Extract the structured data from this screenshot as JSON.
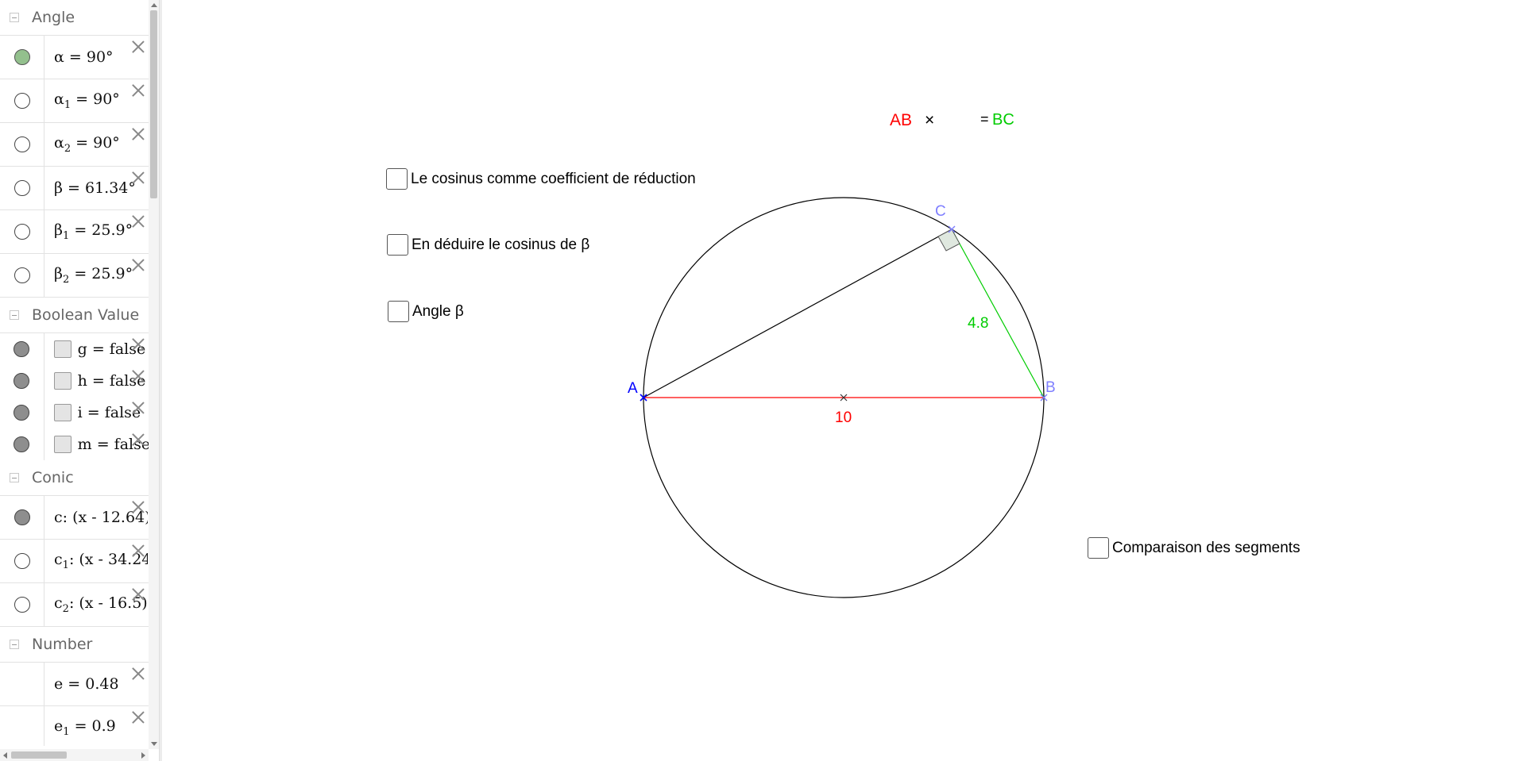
{
  "algebra": {
    "categories": [
      {
        "title": "Angle",
        "items": [
          {
            "name": "α",
            "sub": "",
            "value": "= 90°",
            "marble": "on-green"
          },
          {
            "name": "α",
            "sub": "1",
            "value": "= 90°",
            "marble": "off"
          },
          {
            "name": "α",
            "sub": "2",
            "value": "= 90°",
            "marble": "off"
          },
          {
            "name": "β",
            "sub": "",
            "value": "= 61.34°",
            "marble": "off"
          },
          {
            "name": "β",
            "sub": "1",
            "value": "= 25.9°",
            "marble": "off"
          },
          {
            "name": "β",
            "sub": "2",
            "value": "= 25.9°",
            "marble": "off"
          }
        ]
      },
      {
        "title": "Boolean Value",
        "items": [
          {
            "name": "g",
            "value": "= false",
            "marble": "on"
          },
          {
            "name": "h",
            "value": "= false",
            "marble": "on"
          },
          {
            "name": "i",
            "value": "= false",
            "marble": "on"
          },
          {
            "name": "m",
            "value": "= false",
            "marble": "on"
          }
        ]
      },
      {
        "title": "Conic",
        "items": [
          {
            "name": "c",
            "sub": "",
            "value": ": (x - 12.64)",
            "marble": "on"
          },
          {
            "name": "c",
            "sub": "1",
            "value": ": (x - 34.24",
            "marble": "off"
          },
          {
            "name": "c",
            "sub": "2",
            "value": ": (x - 16.5)",
            "marble": "off"
          }
        ]
      },
      {
        "title": "Number",
        "items": [
          {
            "name": "e",
            "sub": "",
            "value": "= 0.48",
            "marble": "none"
          },
          {
            "name": "e",
            "sub": "1",
            "value": "= 0.9",
            "marble": "none"
          }
        ]
      }
    ]
  },
  "graphics": {
    "checkboxes": {
      "cosinus_reduction": "Le cosinus comme coefficient de réduction",
      "deduire_cosinus": "En déduire le cosinus de β",
      "angle_beta": "Angle β",
      "comparaison": "Comparaison des segments"
    },
    "formula": {
      "ab": "AB",
      "times": "×",
      "equals": "=",
      "bc": "BC"
    },
    "points": {
      "a": "A",
      "b": "B",
      "c": "C"
    },
    "labels": {
      "ab_length": "10",
      "bc_length": "4.8"
    },
    "colors": {
      "red": "#ff0000",
      "green": "#00cc00",
      "point_blue": "#0000ff",
      "point_violet": "#7f7fff",
      "circle": "#000000"
    }
  }
}
